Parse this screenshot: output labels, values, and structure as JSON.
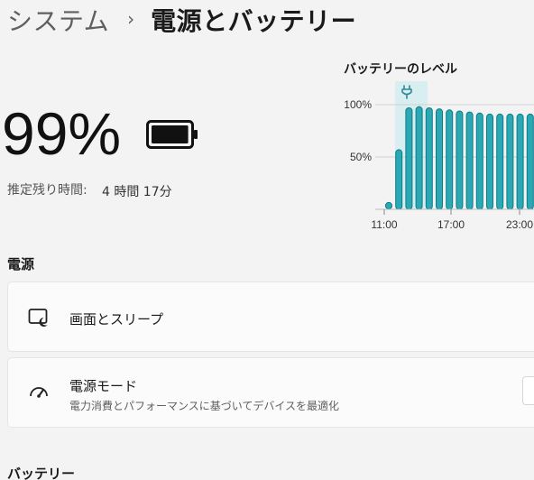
{
  "header": {
    "parent": "システム",
    "separator": "›",
    "current": "電源とバッテリー"
  },
  "battery": {
    "percent": "99%",
    "level": 0.99,
    "remaining_label": "推定残り時間:",
    "remaining_value": "4 時間 17分"
  },
  "chart_data": {
    "type": "bar",
    "title": "バッテリーのレベル",
    "y_ticks": [
      "100%",
      "50%"
    ],
    "x_ticks": [
      "11:00",
      "17:00",
      "23:00"
    ],
    "values": [
      1,
      57,
      97,
      98,
      97,
      96,
      95,
      94,
      93,
      92,
      91,
      91,
      91,
      91,
      91
    ],
    "ylim": [
      0,
      100
    ],
    "charging_icon": "plug-icon",
    "bar_color": "#2aa9b4",
    "bar_outline": "#0e7c86",
    "highlight_color": "#cfe9ec"
  },
  "power": {
    "section_title": "電源",
    "screen_sleep": {
      "title": "画面とスリープ",
      "icon": "screen-sleep-icon"
    },
    "power_mode": {
      "title": "電源モード",
      "subtitle": "電力消費とパフォーマンスに基づいてデバイスを最適化",
      "icon": "gauge-icon"
    }
  },
  "battery_section": {
    "title": "バッテリー"
  }
}
